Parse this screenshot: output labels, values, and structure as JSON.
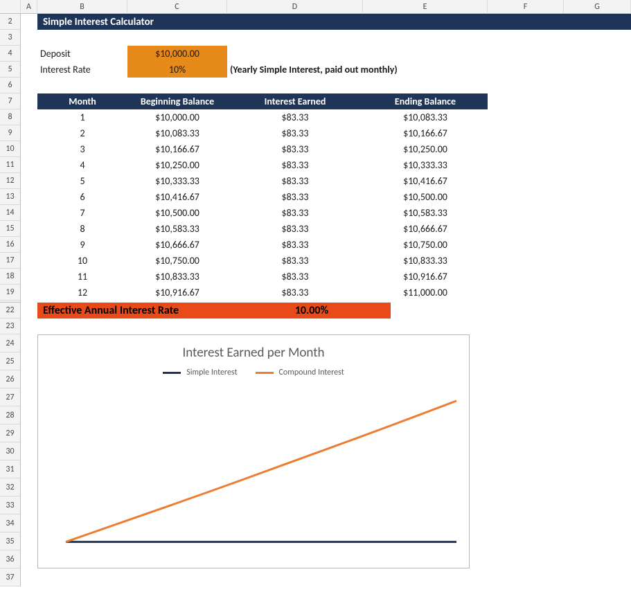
{
  "columns": [
    "A",
    "B",
    "C",
    "D",
    "E",
    "F",
    "G"
  ],
  "rows_visible": [
    "2",
    "3",
    "4",
    "5",
    "6",
    "7",
    "8",
    "9",
    "10",
    "11",
    "12",
    "13",
    "14",
    "15",
    "16",
    "17",
    "18",
    "19",
    "22",
    "23",
    "24",
    "25",
    "26",
    "27",
    "28",
    "29",
    "30",
    "31",
    "32",
    "33",
    "34",
    "35",
    "36",
    "37"
  ],
  "title": "Simple Interest Calculator",
  "inputs": {
    "deposit_label": "Deposit",
    "deposit_value": "$10,000.00",
    "rate_label": "Interest Rate",
    "rate_value": "10%",
    "rate_note": "(Yearly Simple Interest, paid out monthly)"
  },
  "table": {
    "headers": [
      "Month",
      "Beginning Balance",
      "Interest Earned",
      "Ending Balance"
    ],
    "rows": [
      [
        "1",
        "$10,000.00",
        "$83.33",
        "$10,083.33"
      ],
      [
        "2",
        "$10,083.33",
        "$83.33",
        "$10,166.67"
      ],
      [
        "3",
        "$10,166.67",
        "$83.33",
        "$10,250.00"
      ],
      [
        "4",
        "$10,250.00",
        "$83.33",
        "$10,333.33"
      ],
      [
        "5",
        "$10,333.33",
        "$83.33",
        "$10,416.67"
      ],
      [
        "6",
        "$10,416.67",
        "$83.33",
        "$10,500.00"
      ],
      [
        "7",
        "$10,500.00",
        "$83.33",
        "$10,583.33"
      ],
      [
        "8",
        "$10,583.33",
        "$83.33",
        "$10,666.67"
      ],
      [
        "9",
        "$10,666.67",
        "$83.33",
        "$10,750.00"
      ],
      [
        "10",
        "$10,750.00",
        "$83.33",
        "$10,833.33"
      ],
      [
        "11",
        "$10,833.33",
        "$83.33",
        "$10,916.67"
      ],
      [
        "12",
        "$10,916.67",
        "$83.33",
        "$11,000.00"
      ]
    ]
  },
  "effective": {
    "label": "Effective Annual Interest Rate",
    "value": "10.00%"
  },
  "chart": {
    "title": "Interest Earned per Month",
    "legend": [
      "Simple Interest",
      "Compound Interest"
    ]
  },
  "chart_data": {
    "type": "line",
    "title": "Interest Earned per Month",
    "xlabel": "",
    "ylabel": "",
    "x": [
      1,
      2,
      3,
      4,
      5,
      6,
      7,
      8,
      9,
      10,
      11,
      12
    ],
    "series": [
      {
        "name": "Simple Interest",
        "color": "#1f3557",
        "values": [
          83.33,
          83.33,
          83.33,
          83.33,
          83.33,
          83.33,
          83.33,
          83.33,
          83.33,
          83.33,
          83.33,
          83.33
        ]
      },
      {
        "name": "Compound Interest",
        "color": "#ed7d31",
        "values": [
          83.33,
          84.03,
          84.73,
          85.43,
          86.14,
          86.86,
          87.59,
          88.32,
          89.05,
          89.79,
          90.54,
          91.3
        ]
      }
    ],
    "ylim": [
      83,
      92
    ]
  }
}
